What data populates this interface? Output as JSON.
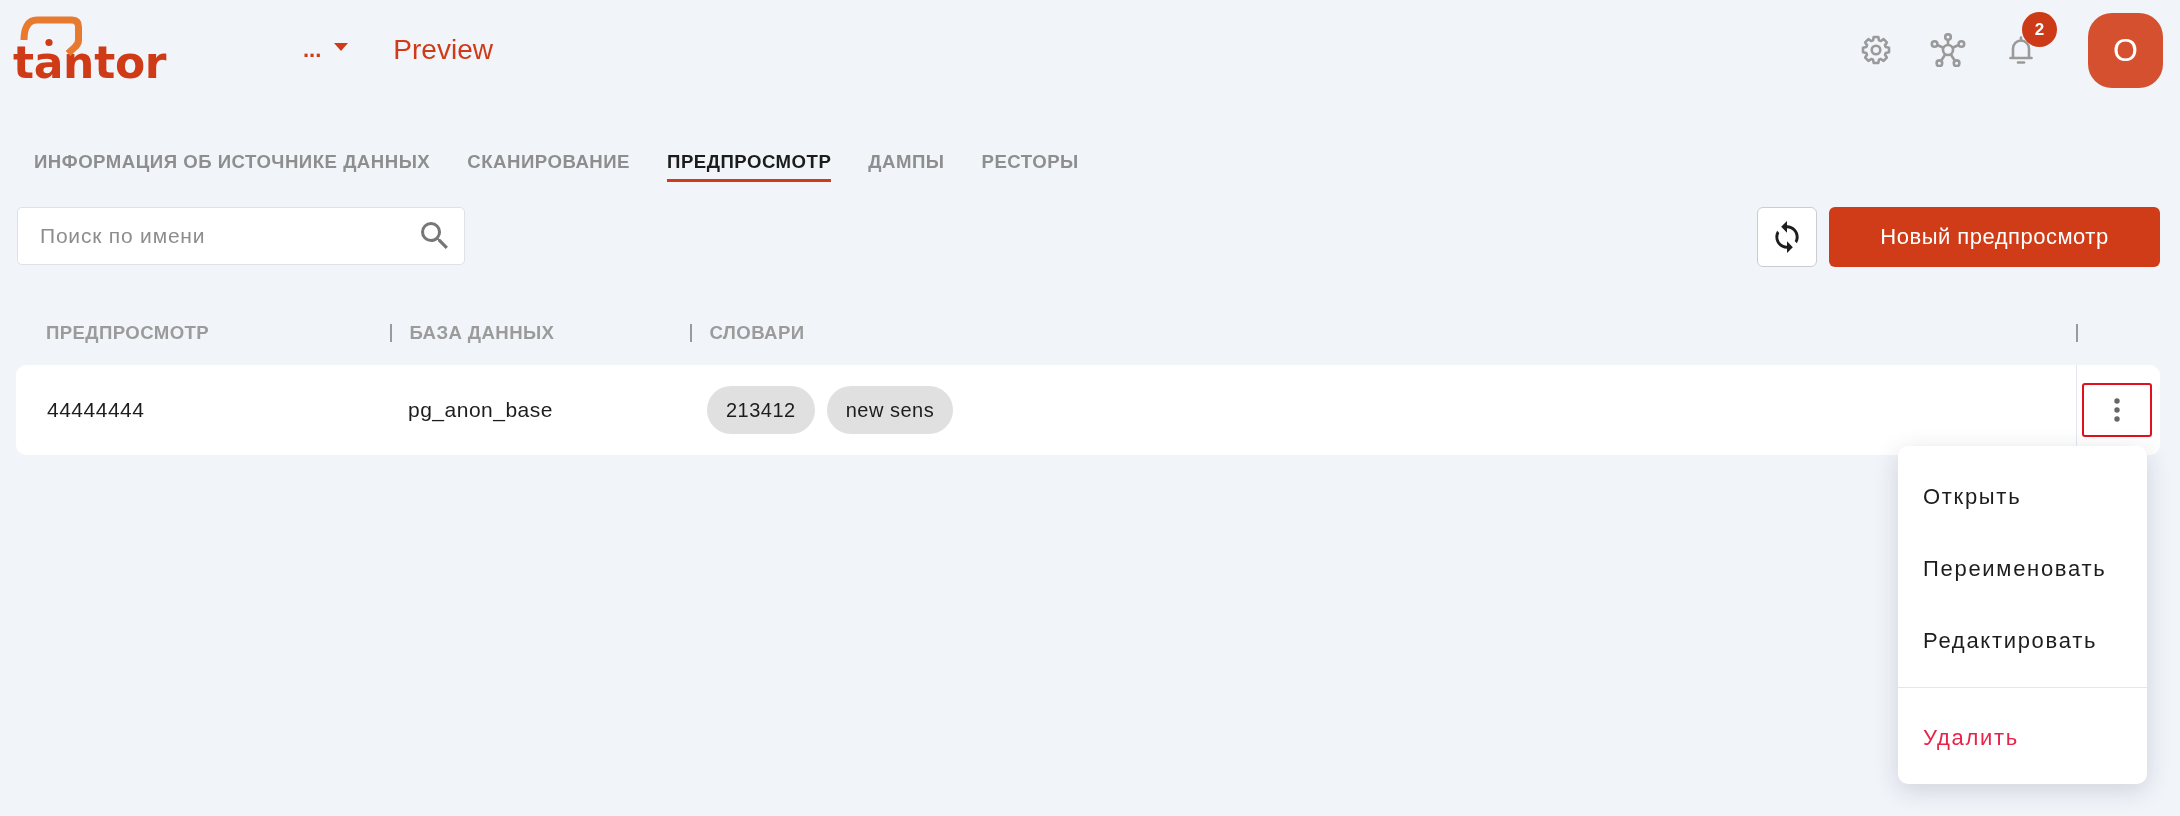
{
  "header": {
    "logo": "tantor",
    "project_selector": {
      "label": "..."
    },
    "title": "Preview",
    "notifications": {
      "count": "2"
    },
    "avatar": {
      "initial": "O"
    }
  },
  "tabs": [
    {
      "label": "ИНФОРМАЦИЯ ОБ ИСТОЧНИКЕ ДАННЫХ",
      "selected": false
    },
    {
      "label": "СКАНИРОВАНИЕ",
      "selected": false
    },
    {
      "label": "ПРЕДПРОСМОТР",
      "selected": true
    },
    {
      "label": "ДАМПЫ",
      "selected": false
    },
    {
      "label": "РЕСТОРЫ",
      "selected": false
    }
  ],
  "toolbar": {
    "search": {
      "placeholder": "Поиск по имени"
    },
    "new_button": {
      "label": "Новый предпросмотр"
    }
  },
  "table": {
    "columns": [
      "ПРЕДПРОСМОТР",
      "БАЗА ДАННЫХ",
      "СЛОВАРИ"
    ],
    "rows": [
      {
        "preview": "44444444",
        "database": "pg_anon_base",
        "dictionaries": [
          "213412",
          "new sens"
        ],
        "actions_focused": true
      }
    ]
  },
  "context_menu": {
    "groups": [
      {
        "items": [
          {
            "label": "Открыть",
            "kind": "normal"
          },
          {
            "label": "Переименовать",
            "kind": "normal"
          },
          {
            "label": "Редактировать",
            "kind": "normal"
          }
        ]
      },
      {
        "items": [
          {
            "label": "Удалить",
            "kind": "danger"
          }
        ]
      }
    ]
  }
}
